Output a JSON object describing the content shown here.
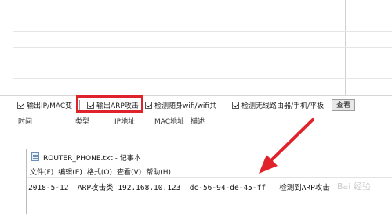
{
  "options": {
    "output_ip_mac": "输出IP/MAC变",
    "output_arp_attack": "输出ARP攻击",
    "detect_wifi": "检测随身wifi/wifi共",
    "detect_wireless_router": "检测无线路由器/手机/平板",
    "view_button": "查看"
  },
  "columns": [
    "时间",
    "类型",
    "IP地址",
    "MAC地址",
    "描述"
  ],
  "notepad": {
    "title": "ROUTER_PHONE.txt - 记事本",
    "menu": [
      "文件(F)",
      "编辑(E)",
      "格式(O)",
      "查看(V)",
      "帮助(H)"
    ],
    "line": "2018-5-12  ARP攻击类 192.168.10.123  dc-56-94-de-45-ff   检测到ARP攻击"
  },
  "watermark": "Bai 经验",
  "colors": {
    "highlight": "#e0222b",
    "arrow": "#e0222b"
  }
}
